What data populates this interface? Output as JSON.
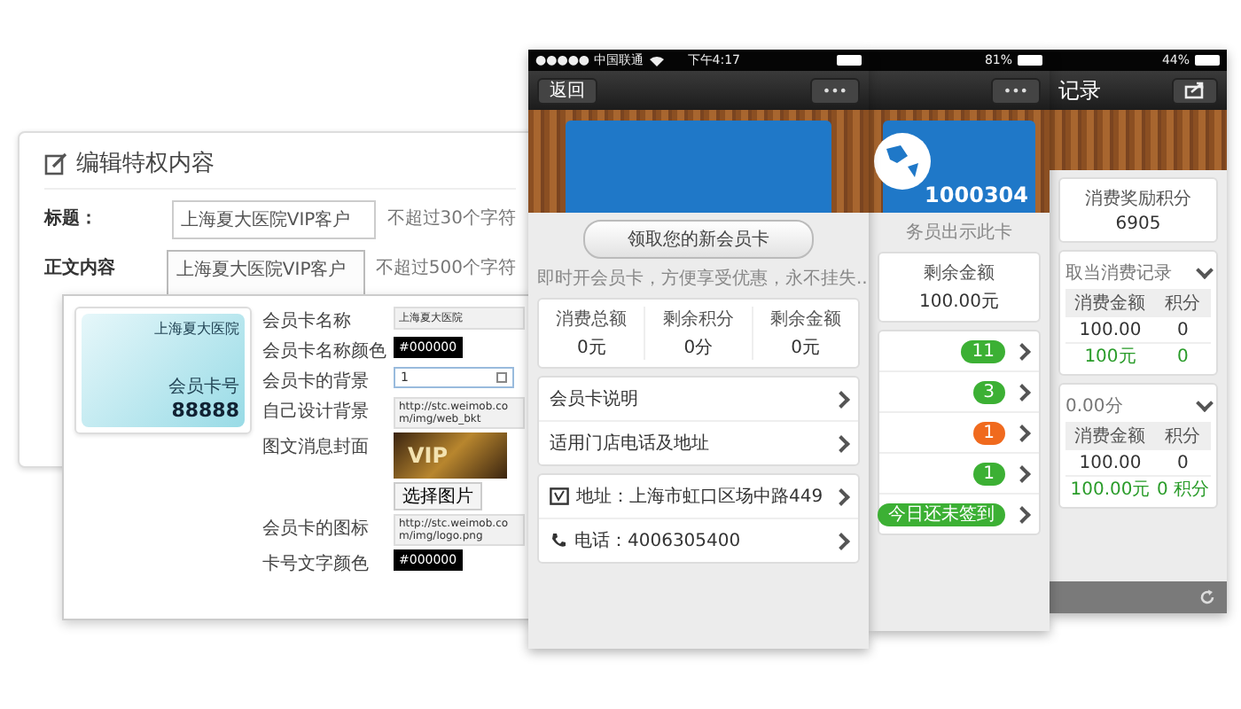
{
  "editor": {
    "title": "编辑特权内容",
    "fields": [
      {
        "label": "标题：",
        "value": "上海夏大医院VIP客户",
        "hint": "不超过30个字符",
        "kind": "input"
      },
      {
        "label": "正文内容",
        "value": "上海夏大医院VIP客户",
        "hint": "不超过500个字符",
        "kind": "textarea"
      }
    ]
  },
  "card_dialog": {
    "card": {
      "issuer": "上海夏大医院",
      "number_label": "会员卡号",
      "number": "88888"
    },
    "fields": [
      {
        "label": "会员卡名称",
        "value": "上海夏大医院",
        "kind": "input"
      },
      {
        "label": "会员卡名称颜色",
        "value": "#000000",
        "kind": "swatch"
      },
      {
        "label": "会员卡的背景",
        "value": "1",
        "kind": "select"
      },
      {
        "label": "自己设计背景",
        "value": "http://stc.weimob.com/img/web_bkt",
        "kind": "input"
      },
      {
        "label": "图文消息封面",
        "value": "VIP",
        "action": "选择图片",
        "kind": "image"
      },
      {
        "label": "会员卡的图标",
        "value": "http://stc.weimob.com/img/logo.png",
        "kind": "input"
      },
      {
        "label": "卡号文字颜色",
        "value": "#000000",
        "kind": "swatch"
      }
    ]
  },
  "phone_1": {
    "status": {
      "carrier": "●●●●● 中国联通",
      "time": "下午4:17"
    },
    "back": "返回",
    "more": "•••",
    "claim_button": "领取您的新会员卡",
    "hint": "即时开会员卡，方便享受优惠，永不挂失...",
    "stats": [
      {
        "label": "消费总额",
        "value": "0元"
      },
      {
        "label": "剩余积分",
        "value": "0分"
      },
      {
        "label": "剩余金额",
        "value": "0元"
      }
    ],
    "groups": [
      [
        {
          "text": "会员卡说明",
          "kind": "plain"
        },
        {
          "text": "适用门店电话及地址",
          "kind": "plain"
        }
      ],
      [
        {
          "text": "地址：上海市虹口区场中路449",
          "kind": "address"
        },
        {
          "text": "电话：4006305400",
          "kind": "phone"
        }
      ]
    ]
  },
  "phone_2": {
    "status": {
      "battery": "81%"
    },
    "more": "•••",
    "card_number": "1000304",
    "hint": "务员出示此卡",
    "stat": {
      "label": "剩余金额",
      "value": "100.00元"
    },
    "badges": [
      {
        "text": "11",
        "color": "#3cb034"
      },
      {
        "text": "3",
        "color": "#3cb034"
      },
      {
        "text": "1",
        "color": "#f06a1e"
      },
      {
        "text": "1",
        "color": "#3cb034"
      },
      {
        "text": "今日还未签到",
        "color": "#3cb034"
      }
    ]
  },
  "phone_3": {
    "status": {
      "battery": "44%"
    },
    "title": "记录",
    "stat": {
      "label": "消费奖励积分",
      "value": "6905"
    },
    "sections": [
      {
        "title": "取当消费记录",
        "columns": [
          "消费金额",
          "积分"
        ],
        "rows": [
          {
            "cells": [
              "100.00",
              "0"
            ],
            "total": false
          },
          {
            "cells": [
              "100元",
              "0"
            ],
            "total": true
          }
        ]
      },
      {
        "title": "0.00分",
        "columns": [
          "消费金额",
          "积分"
        ],
        "rows": [
          {
            "cells": [
              "100.00",
              "0"
            ],
            "total": false
          },
          {
            "cells": [
              "100.00元",
              "0 积分"
            ],
            "total": true
          }
        ]
      }
    ]
  }
}
